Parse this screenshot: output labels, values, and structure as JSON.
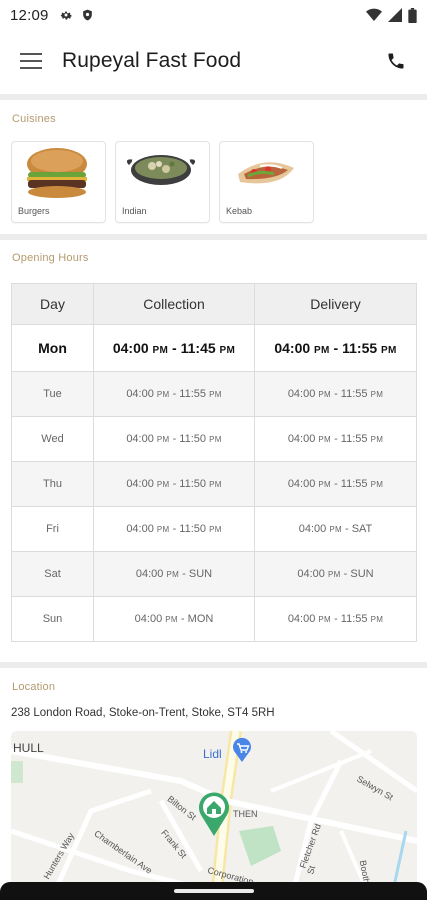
{
  "status_bar": {
    "time": "12:09",
    "icons_left": [
      "gear-icon",
      "shield-icon"
    ],
    "icons_right": [
      "wifi-icon",
      "signal-icon",
      "battery-icon"
    ]
  },
  "app_bar": {
    "title": "Rupeyal Fast Food",
    "menu_icon": "hamburger-menu-icon",
    "phone_icon": "phone-icon"
  },
  "cuisines": {
    "title": "Cuisines",
    "items": [
      {
        "label": "Burgers"
      },
      {
        "label": "Indian"
      },
      {
        "label": "Kebab"
      }
    ]
  },
  "opening_hours": {
    "title": "Opening Hours",
    "headers": {
      "day": "Day",
      "collection": "Collection",
      "delivery": "Delivery"
    },
    "rows": [
      {
        "day": "Mon",
        "col_open": "04:00",
        "col_close": "11:45",
        "del_open": "04:00",
        "del_close": "11:55"
      },
      {
        "day": "Tue",
        "col_open": "04:00",
        "col_close": "11:55",
        "del_open": "04:00",
        "del_close": "11:55"
      },
      {
        "day": "Wed",
        "col_open": "04:00",
        "col_close": "11:50",
        "del_open": "04:00",
        "del_close": "11:55"
      },
      {
        "day": "Thu",
        "col_open": "04:00",
        "col_close": "11:50",
        "del_open": "04:00",
        "del_close": "11:55"
      },
      {
        "day": "Fri",
        "col_open": "04:00",
        "col_close": "11:50",
        "del_open": "04:00",
        "del_close": "SAT"
      },
      {
        "day": "Sat",
        "col_open": "04:00",
        "col_close": "SUN",
        "del_open": "04:00",
        "del_close": "SUN"
      },
      {
        "day": "Sun",
        "col_open": "04:00",
        "col_close": "MON",
        "del_open": "04:00",
        "del_close": "11:55"
      }
    ],
    "pm_suffix": "PM"
  },
  "location": {
    "title": "Location",
    "address": "238 London Road, Stoke-on-Trent, Stoke, ST4 5RH",
    "map_labels": {
      "hull": "HULL",
      "lidl": "Lidl",
      "bilton": "Bilton St",
      "then": "THEN",
      "selwyn": "Selwyn St",
      "hunters": "Hunters Way",
      "chamberlain": "Chamberlain Ave",
      "frank": "Frank St",
      "corporation": "Corporation",
      "fletcher": "Fletcher Rd",
      "ruxton": "St",
      "booth": "Booth"
    },
    "pin_icon": "map-pin-home-icon",
    "store_icon": "shopping-cart-pin-icon"
  },
  "colors": {
    "section_title": "#b59a6e",
    "pin": "#3aa76d",
    "store_pin": "#4a86e8"
  }
}
